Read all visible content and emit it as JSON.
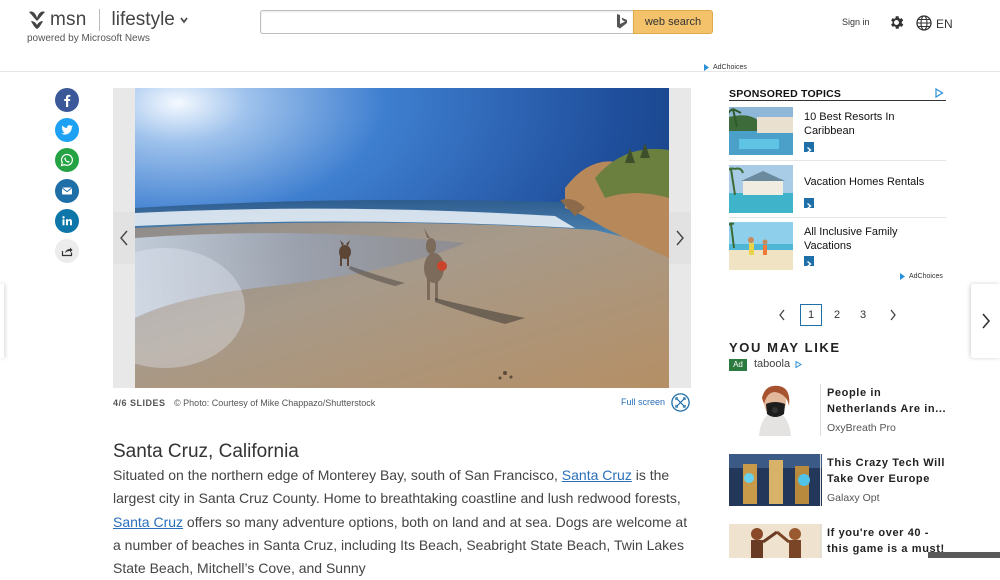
{
  "header": {
    "logo_text": "msn",
    "section": "lifestyle",
    "powered_by": "powered by Microsoft News",
    "search_placeholder": "",
    "search_button": "web search",
    "sign_in": "Sign in",
    "language": "EN",
    "adchoices": "AdChoices"
  },
  "share_icons": [
    "facebook-icon",
    "twitter-icon",
    "whatsapp-icon",
    "email-icon",
    "linkedin-icon",
    "share-icon"
  ],
  "colors": {
    "facebook": "#3b5998",
    "twitter": "#1da1f2",
    "whatsapp": "#25a244",
    "email": "#1e6ea8",
    "linkedin": "#0e76a8",
    "link": "#2a6fba",
    "search_button": "#f3c26b",
    "ad_badge": "#2d7a3f"
  },
  "slideshow": {
    "count": "4/6 SLIDES",
    "credit": "© Photo: Courtesy of Mike Chappazo/Shutterstock",
    "fullscreen": "Full screen"
  },
  "article": {
    "title": "Santa Cruz, California",
    "p1": "Situated on the northern edge of Monterey Bay, south of San Francisco, ",
    "link1": "Santa Cruz",
    "p2": " is the largest city in Santa Cruz County. Home to breathtaking coastline and lush redwood forests, ",
    "link2": "Santa Cruz",
    "p3": " offers so many adventure options, both on land and at sea. Dogs are welcome at a number of beaches in Santa Cruz, including Its Beach, Seabright State Beach, Twin Lakes State Beach, Mitchell’s Cove, and Sunny"
  },
  "sponsored": {
    "title": "SPONSORED TOPICS",
    "items": [
      {
        "label": "10 Best Resorts In Caribbean"
      },
      {
        "label": "Vacation Homes Rentals"
      },
      {
        "label": "All Inclusive Family Vacations"
      }
    ],
    "adchoices": "AdChoices"
  },
  "pager": {
    "pages": [
      "1",
      "2",
      "3"
    ],
    "current": "1"
  },
  "you_may_like": {
    "title": "YOU MAY LIKE",
    "ad_label": "Ad",
    "provider": "taboola",
    "items": [
      {
        "title": "People in Netherlands Are in...",
        "source": "OxyBreath Pro"
      },
      {
        "title": "This Crazy Tech Will Take Over Europe",
        "source": "Galaxy Opt"
      },
      {
        "title": "If you're over 40 - this game is a must!",
        "source": ""
      }
    ]
  }
}
